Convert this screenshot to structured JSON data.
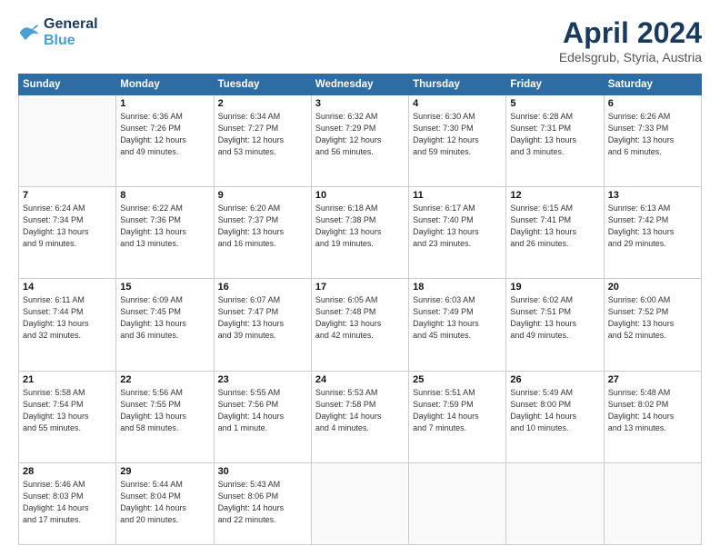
{
  "header": {
    "logo_line1": "General",
    "logo_line2": "Blue",
    "month": "April 2024",
    "location": "Edelsgrub, Styria, Austria"
  },
  "days_of_week": [
    "Sunday",
    "Monday",
    "Tuesday",
    "Wednesday",
    "Thursday",
    "Friday",
    "Saturday"
  ],
  "weeks": [
    [
      {
        "num": "",
        "info": ""
      },
      {
        "num": "1",
        "info": "Sunrise: 6:36 AM\nSunset: 7:26 PM\nDaylight: 12 hours\nand 49 minutes."
      },
      {
        "num": "2",
        "info": "Sunrise: 6:34 AM\nSunset: 7:27 PM\nDaylight: 12 hours\nand 53 minutes."
      },
      {
        "num": "3",
        "info": "Sunrise: 6:32 AM\nSunset: 7:29 PM\nDaylight: 12 hours\nand 56 minutes."
      },
      {
        "num": "4",
        "info": "Sunrise: 6:30 AM\nSunset: 7:30 PM\nDaylight: 12 hours\nand 59 minutes."
      },
      {
        "num": "5",
        "info": "Sunrise: 6:28 AM\nSunset: 7:31 PM\nDaylight: 13 hours\nand 3 minutes."
      },
      {
        "num": "6",
        "info": "Sunrise: 6:26 AM\nSunset: 7:33 PM\nDaylight: 13 hours\nand 6 minutes."
      }
    ],
    [
      {
        "num": "7",
        "info": "Sunrise: 6:24 AM\nSunset: 7:34 PM\nDaylight: 13 hours\nand 9 minutes."
      },
      {
        "num": "8",
        "info": "Sunrise: 6:22 AM\nSunset: 7:36 PM\nDaylight: 13 hours\nand 13 minutes."
      },
      {
        "num": "9",
        "info": "Sunrise: 6:20 AM\nSunset: 7:37 PM\nDaylight: 13 hours\nand 16 minutes."
      },
      {
        "num": "10",
        "info": "Sunrise: 6:18 AM\nSunset: 7:38 PM\nDaylight: 13 hours\nand 19 minutes."
      },
      {
        "num": "11",
        "info": "Sunrise: 6:17 AM\nSunset: 7:40 PM\nDaylight: 13 hours\nand 23 minutes."
      },
      {
        "num": "12",
        "info": "Sunrise: 6:15 AM\nSunset: 7:41 PM\nDaylight: 13 hours\nand 26 minutes."
      },
      {
        "num": "13",
        "info": "Sunrise: 6:13 AM\nSunset: 7:42 PM\nDaylight: 13 hours\nand 29 minutes."
      }
    ],
    [
      {
        "num": "14",
        "info": "Sunrise: 6:11 AM\nSunset: 7:44 PM\nDaylight: 13 hours\nand 32 minutes."
      },
      {
        "num": "15",
        "info": "Sunrise: 6:09 AM\nSunset: 7:45 PM\nDaylight: 13 hours\nand 36 minutes."
      },
      {
        "num": "16",
        "info": "Sunrise: 6:07 AM\nSunset: 7:47 PM\nDaylight: 13 hours\nand 39 minutes."
      },
      {
        "num": "17",
        "info": "Sunrise: 6:05 AM\nSunset: 7:48 PM\nDaylight: 13 hours\nand 42 minutes."
      },
      {
        "num": "18",
        "info": "Sunrise: 6:03 AM\nSunset: 7:49 PM\nDaylight: 13 hours\nand 45 minutes."
      },
      {
        "num": "19",
        "info": "Sunrise: 6:02 AM\nSunset: 7:51 PM\nDaylight: 13 hours\nand 49 minutes."
      },
      {
        "num": "20",
        "info": "Sunrise: 6:00 AM\nSunset: 7:52 PM\nDaylight: 13 hours\nand 52 minutes."
      }
    ],
    [
      {
        "num": "21",
        "info": "Sunrise: 5:58 AM\nSunset: 7:54 PM\nDaylight: 13 hours\nand 55 minutes."
      },
      {
        "num": "22",
        "info": "Sunrise: 5:56 AM\nSunset: 7:55 PM\nDaylight: 13 hours\nand 58 minutes."
      },
      {
        "num": "23",
        "info": "Sunrise: 5:55 AM\nSunset: 7:56 PM\nDaylight: 14 hours\nand 1 minute."
      },
      {
        "num": "24",
        "info": "Sunrise: 5:53 AM\nSunset: 7:58 PM\nDaylight: 14 hours\nand 4 minutes."
      },
      {
        "num": "25",
        "info": "Sunrise: 5:51 AM\nSunset: 7:59 PM\nDaylight: 14 hours\nand 7 minutes."
      },
      {
        "num": "26",
        "info": "Sunrise: 5:49 AM\nSunset: 8:00 PM\nDaylight: 14 hours\nand 10 minutes."
      },
      {
        "num": "27",
        "info": "Sunrise: 5:48 AM\nSunset: 8:02 PM\nDaylight: 14 hours\nand 13 minutes."
      }
    ],
    [
      {
        "num": "28",
        "info": "Sunrise: 5:46 AM\nSunset: 8:03 PM\nDaylight: 14 hours\nand 17 minutes."
      },
      {
        "num": "29",
        "info": "Sunrise: 5:44 AM\nSunset: 8:04 PM\nDaylight: 14 hours\nand 20 minutes."
      },
      {
        "num": "30",
        "info": "Sunrise: 5:43 AM\nSunset: 8:06 PM\nDaylight: 14 hours\nand 22 minutes."
      },
      {
        "num": "",
        "info": ""
      },
      {
        "num": "",
        "info": ""
      },
      {
        "num": "",
        "info": ""
      },
      {
        "num": "",
        "info": ""
      }
    ]
  ]
}
